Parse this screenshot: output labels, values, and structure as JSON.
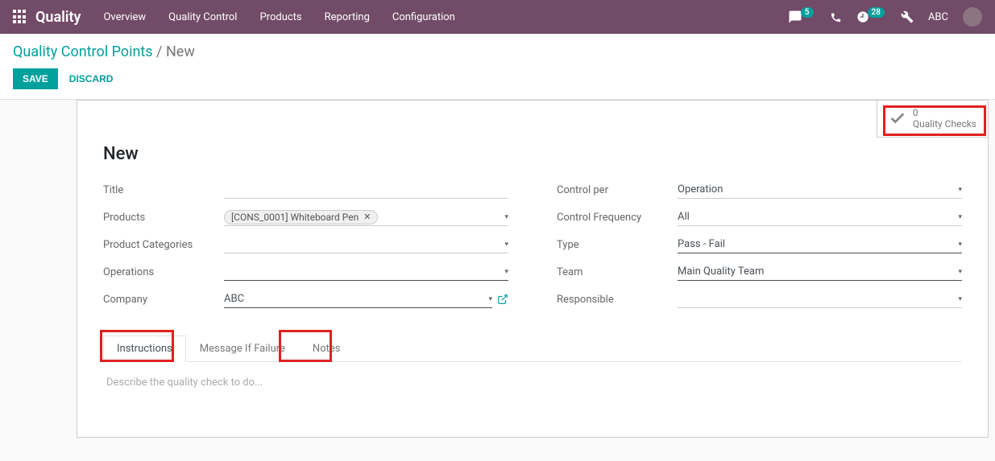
{
  "topnav": {
    "brand": "Quality",
    "menu": [
      "Overview",
      "Quality Control",
      "Products",
      "Reporting",
      "Configuration"
    ],
    "msg_badge": "5",
    "clock_badge": "28",
    "user": "ABC"
  },
  "breadcrumb": {
    "parent": "Quality Control Points",
    "current": "New"
  },
  "buttons": {
    "save": "SAVE",
    "discard": "DISCARD"
  },
  "stat": {
    "count": "0",
    "label": "Quality Checks"
  },
  "record_title": "New",
  "left_fields": {
    "title_label": "Title",
    "products_label": "Products",
    "products_tag": "[CONS_0001] Whiteboard Pen",
    "categories_label": "Product Categories",
    "operations_label": "Operations",
    "company_label": "Company",
    "company_value": "ABC"
  },
  "right_fields": {
    "control_per_label": "Control per",
    "control_per_value": "Operation",
    "control_freq_label": "Control Frequency",
    "control_freq_value": "All",
    "type_label": "Type",
    "type_value": "Pass - Fail",
    "team_label": "Team",
    "team_value": "Main Quality Team",
    "responsible_label": "Responsible"
  },
  "tabs": {
    "instructions": "Instructions",
    "failure": "Message If Failure",
    "notes": "Notes"
  },
  "tab_placeholder": "Describe the quality check to do..."
}
